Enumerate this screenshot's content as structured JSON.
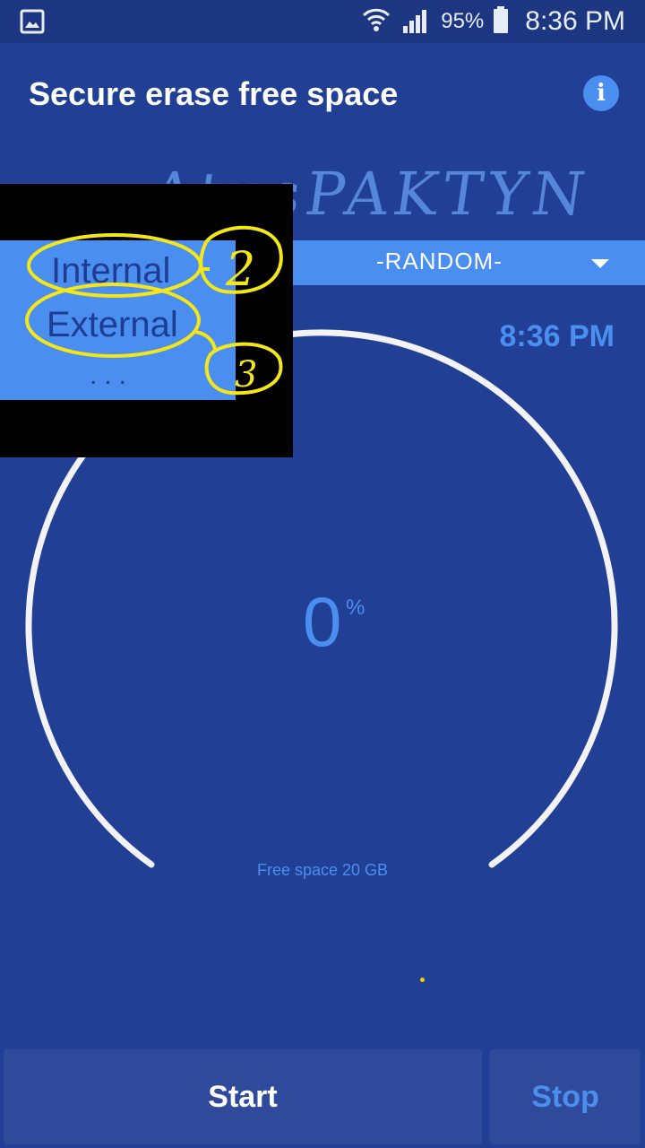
{
  "status_bar": {
    "left_icon": "gallery-icon",
    "wifi_icon": "wifi-icon",
    "signal_icon": "signal-icon",
    "battery_percent": "95%",
    "battery_icon": "battery-icon",
    "time": "8:36 PM"
  },
  "header": {
    "title": "Secure erase free space",
    "info_icon": "info-icon",
    "info_glyph": "i"
  },
  "handwriting": {
    "text": "AtusPAKTYN"
  },
  "mode_selector": {
    "selected": "-RANDOM-",
    "icon": "dropdown-caret-icon"
  },
  "time_label": "8:36 PM",
  "gauge": {
    "percent_value": "0",
    "percent_sign": "%",
    "progress": 0,
    "free_space": "Free space 20 GB"
  },
  "storage_dropdown": {
    "options": [
      "Internal",
      "External"
    ],
    "more": "...",
    "annotations": [
      "2",
      "3"
    ]
  },
  "buttons": {
    "start": "Start",
    "stop": "Stop"
  },
  "colors": {
    "background": "#213f94",
    "status_bar": "#1c3682",
    "accent": "#4a8ff0",
    "gauge_ring": "#f2f2f8",
    "annotation": "#f5e61a",
    "button_bg": "#2f4a9a"
  }
}
